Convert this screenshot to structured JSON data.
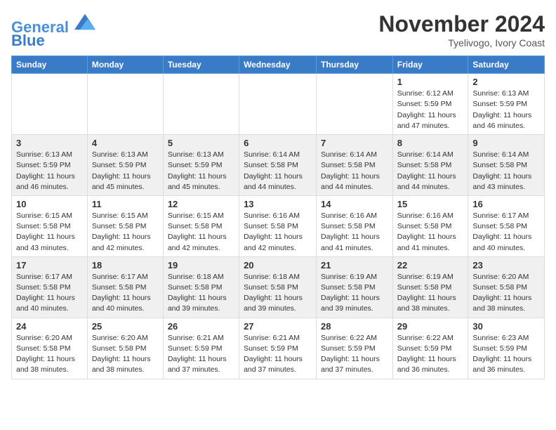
{
  "logo": {
    "line1": "General",
    "line2": "Blue"
  },
  "header": {
    "month": "November 2024",
    "location": "Tyelivogo, Ivory Coast"
  },
  "columns": [
    "Sunday",
    "Monday",
    "Tuesday",
    "Wednesday",
    "Thursday",
    "Friday",
    "Saturday"
  ],
  "weeks": [
    [
      {
        "day": "",
        "info": ""
      },
      {
        "day": "",
        "info": ""
      },
      {
        "day": "",
        "info": ""
      },
      {
        "day": "",
        "info": ""
      },
      {
        "day": "",
        "info": ""
      },
      {
        "day": "1",
        "info": "Sunrise: 6:12 AM\nSunset: 5:59 PM\nDaylight: 11 hours and 47 minutes."
      },
      {
        "day": "2",
        "info": "Sunrise: 6:13 AM\nSunset: 5:59 PM\nDaylight: 11 hours and 46 minutes."
      }
    ],
    [
      {
        "day": "3",
        "info": "Sunrise: 6:13 AM\nSunset: 5:59 PM\nDaylight: 11 hours and 46 minutes."
      },
      {
        "day": "4",
        "info": "Sunrise: 6:13 AM\nSunset: 5:59 PM\nDaylight: 11 hours and 45 minutes."
      },
      {
        "day": "5",
        "info": "Sunrise: 6:13 AM\nSunset: 5:59 PM\nDaylight: 11 hours and 45 minutes."
      },
      {
        "day": "6",
        "info": "Sunrise: 6:14 AM\nSunset: 5:58 PM\nDaylight: 11 hours and 44 minutes."
      },
      {
        "day": "7",
        "info": "Sunrise: 6:14 AM\nSunset: 5:58 PM\nDaylight: 11 hours and 44 minutes."
      },
      {
        "day": "8",
        "info": "Sunrise: 6:14 AM\nSunset: 5:58 PM\nDaylight: 11 hours and 44 minutes."
      },
      {
        "day": "9",
        "info": "Sunrise: 6:14 AM\nSunset: 5:58 PM\nDaylight: 11 hours and 43 minutes."
      }
    ],
    [
      {
        "day": "10",
        "info": "Sunrise: 6:15 AM\nSunset: 5:58 PM\nDaylight: 11 hours and 43 minutes."
      },
      {
        "day": "11",
        "info": "Sunrise: 6:15 AM\nSunset: 5:58 PM\nDaylight: 11 hours and 42 minutes."
      },
      {
        "day": "12",
        "info": "Sunrise: 6:15 AM\nSunset: 5:58 PM\nDaylight: 11 hours and 42 minutes."
      },
      {
        "day": "13",
        "info": "Sunrise: 6:16 AM\nSunset: 5:58 PM\nDaylight: 11 hours and 42 minutes."
      },
      {
        "day": "14",
        "info": "Sunrise: 6:16 AM\nSunset: 5:58 PM\nDaylight: 11 hours and 41 minutes."
      },
      {
        "day": "15",
        "info": "Sunrise: 6:16 AM\nSunset: 5:58 PM\nDaylight: 11 hours and 41 minutes."
      },
      {
        "day": "16",
        "info": "Sunrise: 6:17 AM\nSunset: 5:58 PM\nDaylight: 11 hours and 40 minutes."
      }
    ],
    [
      {
        "day": "17",
        "info": "Sunrise: 6:17 AM\nSunset: 5:58 PM\nDaylight: 11 hours and 40 minutes."
      },
      {
        "day": "18",
        "info": "Sunrise: 6:17 AM\nSunset: 5:58 PM\nDaylight: 11 hours and 40 minutes."
      },
      {
        "day": "19",
        "info": "Sunrise: 6:18 AM\nSunset: 5:58 PM\nDaylight: 11 hours and 39 minutes."
      },
      {
        "day": "20",
        "info": "Sunrise: 6:18 AM\nSunset: 5:58 PM\nDaylight: 11 hours and 39 minutes."
      },
      {
        "day": "21",
        "info": "Sunrise: 6:19 AM\nSunset: 5:58 PM\nDaylight: 11 hours and 39 minutes."
      },
      {
        "day": "22",
        "info": "Sunrise: 6:19 AM\nSunset: 5:58 PM\nDaylight: 11 hours and 38 minutes."
      },
      {
        "day": "23",
        "info": "Sunrise: 6:20 AM\nSunset: 5:58 PM\nDaylight: 11 hours and 38 minutes."
      }
    ],
    [
      {
        "day": "24",
        "info": "Sunrise: 6:20 AM\nSunset: 5:58 PM\nDaylight: 11 hours and 38 minutes."
      },
      {
        "day": "25",
        "info": "Sunrise: 6:20 AM\nSunset: 5:58 PM\nDaylight: 11 hours and 38 minutes."
      },
      {
        "day": "26",
        "info": "Sunrise: 6:21 AM\nSunset: 5:59 PM\nDaylight: 11 hours and 37 minutes."
      },
      {
        "day": "27",
        "info": "Sunrise: 6:21 AM\nSunset: 5:59 PM\nDaylight: 11 hours and 37 minutes."
      },
      {
        "day": "28",
        "info": "Sunrise: 6:22 AM\nSunset: 5:59 PM\nDaylight: 11 hours and 37 minutes."
      },
      {
        "day": "29",
        "info": "Sunrise: 6:22 AM\nSunset: 5:59 PM\nDaylight: 11 hours and 36 minutes."
      },
      {
        "day": "30",
        "info": "Sunrise: 6:23 AM\nSunset: 5:59 PM\nDaylight: 11 hours and 36 minutes."
      }
    ]
  ]
}
